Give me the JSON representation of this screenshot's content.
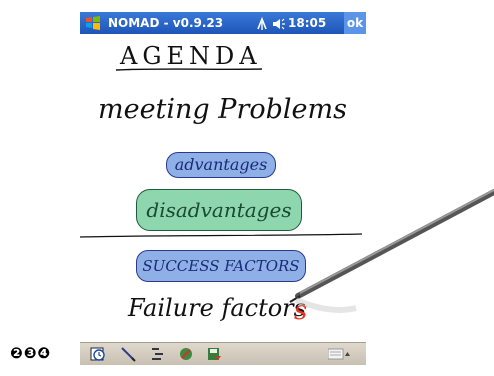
{
  "titlebar": {
    "app_title": "NOMAD - v0.9.23",
    "clock": "18:05",
    "ok_label": "ok"
  },
  "canvas": {
    "heading": "AGENDA",
    "line1": "meeting Problems",
    "pill1": "advantages",
    "pill2": "disadvantages",
    "pill3": "SUCCESS FACTORS",
    "line2": "Failure factors",
    "pill1_color": "#8fb0e6",
    "pill2_color": "#8ed6ae",
    "pill3_color": "#8fb0e6",
    "cursor_color": "#e8321e"
  },
  "toolbar": {
    "icons": [
      "clock-icon",
      "pen-icon",
      "outline-icon",
      "brush-icon",
      "save-icon",
      "keyboard-icon"
    ]
  },
  "badges": "❷❸❹"
}
